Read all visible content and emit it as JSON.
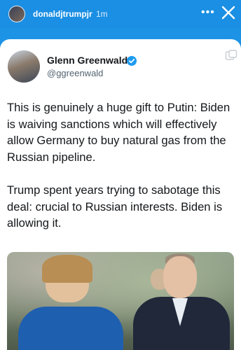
{
  "story": {
    "username": "donaldjtrumpjr",
    "time_ago": "1m",
    "more_label": "•••",
    "close_icon": "close-icon"
  },
  "tweet": {
    "author_name": "Glenn Greenwald",
    "handle": "@ggreenwald",
    "verified_icon": "verified-badge-icon",
    "paragraphs": [
      "This is genuinely a huge gift to Putin: Biden is waiving sanctions which will effectively allow Germany to buy natural gas from the Russian pipeline.",
      "Trump spent years trying to sabotage this deal: crucial to Russian interests. Biden is allowing it."
    ]
  },
  "colors": {
    "story_background": "#1d93e6",
    "card_background": "#ffffff",
    "verified_blue": "#1d9bf0"
  }
}
